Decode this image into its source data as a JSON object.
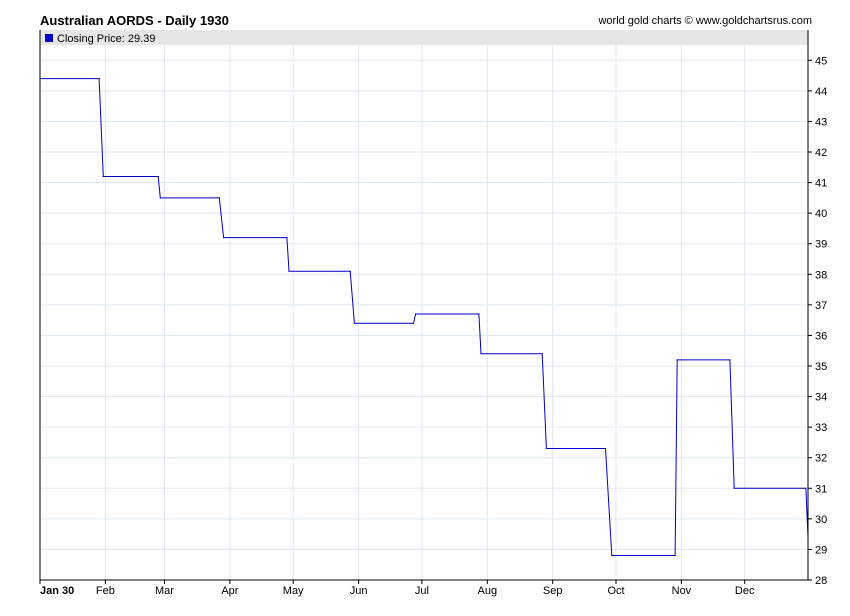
{
  "header": {
    "title": "Australian AORDS - Daily 1930",
    "credit": "world gold charts © www.goldchartsrus.com"
  },
  "legend": {
    "label": "Closing Price: 29.39"
  },
  "colors": {
    "series": "#0000cc",
    "grid": "#dde8ee",
    "legend_bg": "#e6e6e6"
  },
  "chart_data": {
    "type": "line",
    "title": "Australian AORDS - Daily 1930",
    "xlabel": "",
    "ylabel": "",
    "ylim": [
      28,
      45.5
    ],
    "y_ticks": [
      28,
      29,
      30,
      31,
      32,
      33,
      34,
      35,
      36,
      37,
      38,
      39,
      40,
      41,
      42,
      43,
      44,
      45
    ],
    "x_ticks": [
      {
        "label": "Jan 30",
        "day": 0
      },
      {
        "label": "Feb",
        "day": 31
      },
      {
        "label": "Mar",
        "day": 59
      },
      {
        "label": "Apr",
        "day": 90
      },
      {
        "label": "May",
        "day": 120
      },
      {
        "label": "Jun",
        "day": 151
      },
      {
        "label": "Jul",
        "day": 181
      },
      {
        "label": "Aug",
        "day": 212
      },
      {
        "label": "Sep",
        "day": 243
      },
      {
        "label": "Oct",
        "day": 273
      },
      {
        "label": "Nov",
        "day": 304
      },
      {
        "label": "Dec",
        "day": 334
      }
    ],
    "x_domain": [
      0,
      364
    ],
    "grid": true,
    "legend_position": "top-left",
    "series": [
      {
        "name": "Closing Price",
        "color": "#0000cc",
        "points": [
          [
            0,
            44.4
          ],
          [
            28,
            44.4
          ],
          [
            30,
            41.2
          ],
          [
            56,
            41.2
          ],
          [
            57,
            40.5
          ],
          [
            85,
            40.5
          ],
          [
            87,
            39.2
          ],
          [
            117,
            39.2
          ],
          [
            118,
            38.1
          ],
          [
            147,
            38.1
          ],
          [
            149,
            36.4
          ],
          [
            177,
            36.4
          ],
          [
            178,
            36.7
          ],
          [
            208,
            36.7
          ],
          [
            209,
            35.4
          ],
          [
            238,
            35.4
          ],
          [
            240,
            32.3
          ],
          [
            268,
            32.3
          ],
          [
            271,
            28.8
          ],
          [
            301,
            28.8
          ],
          [
            302,
            35.2
          ],
          [
            327,
            35.2
          ],
          [
            329,
            31.0
          ],
          [
            363,
            31.0
          ],
          [
            364,
            29.39
          ]
        ]
      }
    ],
    "last_value": 29.39
  }
}
